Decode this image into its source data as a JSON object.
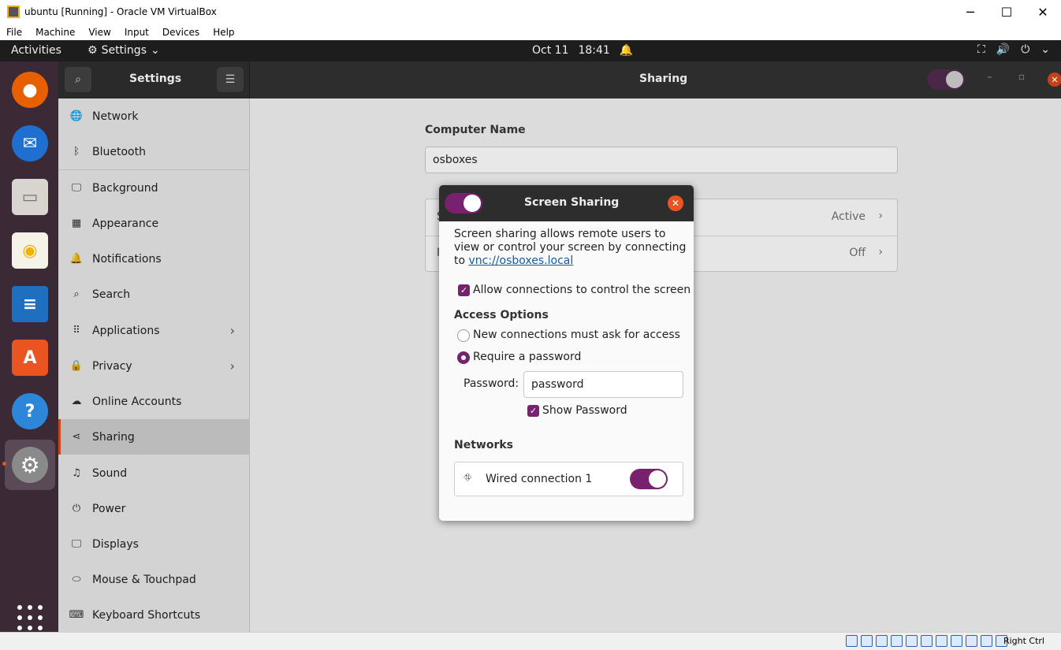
{
  "window": {
    "title": "ubuntu [Running] - Oracle VM VirtualBox",
    "min": "─",
    "max": "☐",
    "close": "✕"
  },
  "menubar": [
    "File",
    "Machine",
    "View",
    "Input",
    "Devices",
    "Help"
  ],
  "topbar": {
    "activities": "Activities",
    "app_menu": "Settings",
    "date": "Oct 11",
    "time": "18:41"
  },
  "dock": [
    {
      "name": "firefox",
      "color": "#e66000"
    },
    {
      "name": "thunderbird",
      "color": "#1f6fd0"
    },
    {
      "name": "files",
      "color": "#d8d4cf"
    },
    {
      "name": "rhythmbox",
      "color": "#f0b400"
    },
    {
      "name": "libreoffice-writer",
      "color": "#1e6fbf"
    },
    {
      "name": "ubuntu-software",
      "color": "#e95420"
    },
    {
      "name": "help",
      "color": "#2e86d8"
    },
    {
      "name": "settings",
      "color": "#8a8a8a"
    }
  ],
  "header": {
    "left_title": "Settings",
    "right_title": "Sharing"
  },
  "sidebar": [
    {
      "label": "Network",
      "icon": "🌐"
    },
    {
      "label": "Bluetooth",
      "icon": "ᛒ"
    },
    {
      "label": "Background",
      "icon": "🖵"
    },
    {
      "label": "Appearance",
      "icon": "▦"
    },
    {
      "label": "Notifications",
      "icon": "🔔"
    },
    {
      "label": "Search",
      "icon": "⌕"
    },
    {
      "label": "Applications",
      "icon": "⠿",
      "chevron": "›"
    },
    {
      "label": "Privacy",
      "icon": "🔒",
      "chevron": "›"
    },
    {
      "label": "Online Accounts",
      "icon": "☁"
    },
    {
      "label": "Sharing",
      "icon": "⋖"
    },
    {
      "label": "Sound",
      "icon": "♫"
    },
    {
      "label": "Power",
      "icon": "⏻"
    },
    {
      "label": "Displays",
      "icon": "🖵"
    },
    {
      "label": "Mouse & Touchpad",
      "icon": "⬭"
    },
    {
      "label": "Keyboard Shortcuts",
      "icon": "⌨"
    }
  ],
  "main": {
    "computer_name_label": "Computer Name",
    "computer_name": "osboxes",
    "rows": [
      {
        "label": "S",
        "value": "Active",
        "chevron": "›"
      },
      {
        "label": "M",
        "value": "Off",
        "chevron": "›"
      }
    ]
  },
  "dialog": {
    "title": "Screen Sharing",
    "close": "✕",
    "description": "Screen sharing allows remote users to view or control your screen by connecting to",
    "link": "vnc://osboxes.local",
    "allow_control": "Allow connections to control the screen",
    "access_options": "Access Options",
    "option_ask": "New connections must ask for access",
    "option_password": "Require a password",
    "password_label": "Password:",
    "password_value": "password",
    "show_password": "Show Password",
    "networks": "Networks",
    "network_name": "Wired connection 1"
  },
  "statusbar": {
    "host_key": "Right Ctrl"
  }
}
